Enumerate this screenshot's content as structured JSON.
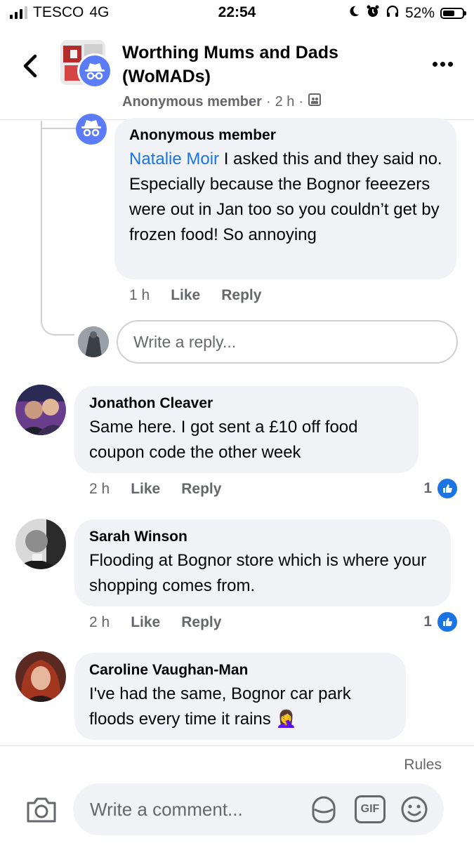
{
  "status_bar": {
    "carrier": "TESCO",
    "network": "4G",
    "time": "22:54",
    "battery": "52%",
    "battery_level": 0.52
  },
  "header": {
    "group_name": "Worthing Mums and Dads (WoMADs)",
    "author": "Anonymous member",
    "age": "2 h",
    "separator": "·"
  },
  "reply": {
    "author": "Anonymous member",
    "mention": "Natalie Moir",
    "text": " I asked this and they said no. Especially because the Bognor feeezers were out in Jan too so you couldn’t get by frozen food! So annoying",
    "time": "1 h",
    "like_label": "Like",
    "reply_label": "Reply"
  },
  "reply_input": {
    "placeholder": "Write a reply..."
  },
  "comments": [
    {
      "name": "Jonathon Cleaver",
      "text": "Same here.  I got sent a £10 off food coupon code the other week",
      "time": "2 h",
      "like_label": "Like",
      "reply_label": "Reply",
      "reactions": "1"
    },
    {
      "name": "Sarah Winson",
      "text": "Flooding at Bognor store which is where your shopping comes from.",
      "time": "2 h",
      "like_label": "Like",
      "reply_label": "Reply",
      "reactions": "1"
    },
    {
      "name": "Caroline Vaughan-Man",
      "text": "I've had the same, Bognor car park floods every time it rains",
      "emoji": "🤦‍♀️"
    }
  ],
  "composer": {
    "rules": "Rules",
    "placeholder": "Write a comment...",
    "gif_label": "GIF"
  },
  "colors": {
    "link": "#1b74e4",
    "bubble": "#f0f2f5",
    "secondary_text": "#65676b",
    "anon_badge": "#5b7cf6"
  },
  "icons": [
    "signal-icon",
    "moon-icon",
    "alarm-icon",
    "headphones-icon",
    "battery-icon",
    "back-icon",
    "more-icon",
    "group-icon",
    "anonymous-icon",
    "like-icon",
    "camera-icon",
    "sticker-icon",
    "gif-icon",
    "emoji-icon"
  ]
}
